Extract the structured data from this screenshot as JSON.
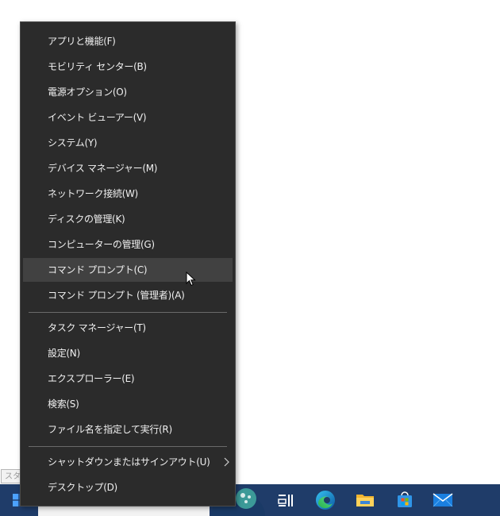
{
  "menu": {
    "items": [
      {
        "label": "アプリと機能(F)"
      },
      {
        "label": "モビリティ センター(B)"
      },
      {
        "label": "電源オプション(O)"
      },
      {
        "label": "イベント ビューアー(V)"
      },
      {
        "label": "システム(Y)"
      },
      {
        "label": "デバイス マネージャー(M)"
      },
      {
        "label": "ネットワーク接続(W)"
      },
      {
        "label": "ディスクの管理(K)"
      },
      {
        "label": "コンピューターの管理(G)"
      },
      {
        "label": "コマンド プロンプト(C)"
      },
      {
        "label": "コマンド プロンプト (管理者)(A)"
      },
      {
        "label": "タスク マネージャー(T)"
      },
      {
        "label": "設定(N)"
      },
      {
        "label": "エクスプローラー(E)"
      },
      {
        "label": "検索(S)"
      },
      {
        "label": "ファイル名を指定して実行(R)"
      },
      {
        "label": "シャットダウンまたはサインアウト(U)"
      },
      {
        "label": "デスクトップ(D)"
      }
    ],
    "hovered_item": "コマンド プロンプト(C)"
  },
  "tooltip": {
    "text": "スタート"
  },
  "taskbar": {
    "icons": [
      "windows-start-icon",
      "task-view-icon",
      "edge-browser-icon",
      "file-explorer-icon",
      "microsoft-store-icon",
      "mail-icon"
    ]
  },
  "colors": {
    "menu_bg": "#2b2b2b",
    "menu_hover": "#414141",
    "taskbar_bg": "#1f3c69"
  }
}
